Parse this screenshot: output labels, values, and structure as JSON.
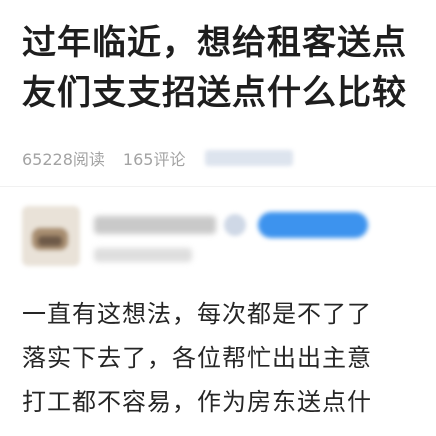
{
  "post": {
    "title_lines": [
      "过年临近，想给租客送点",
      "友们支支招送点什么比较"
    ],
    "reads": "65228阅读",
    "comments": "165评论",
    "body_lines": [
      "一直有这想法，每次都是不了了",
      "落实下去了，各位帮忙出出主意",
      "打工都不容易，作为房东送点什"
    ]
  },
  "colors": {
    "title": "#1e1e1e",
    "meta": "#a3a3a3",
    "follow_button": "#3d93ee"
  }
}
